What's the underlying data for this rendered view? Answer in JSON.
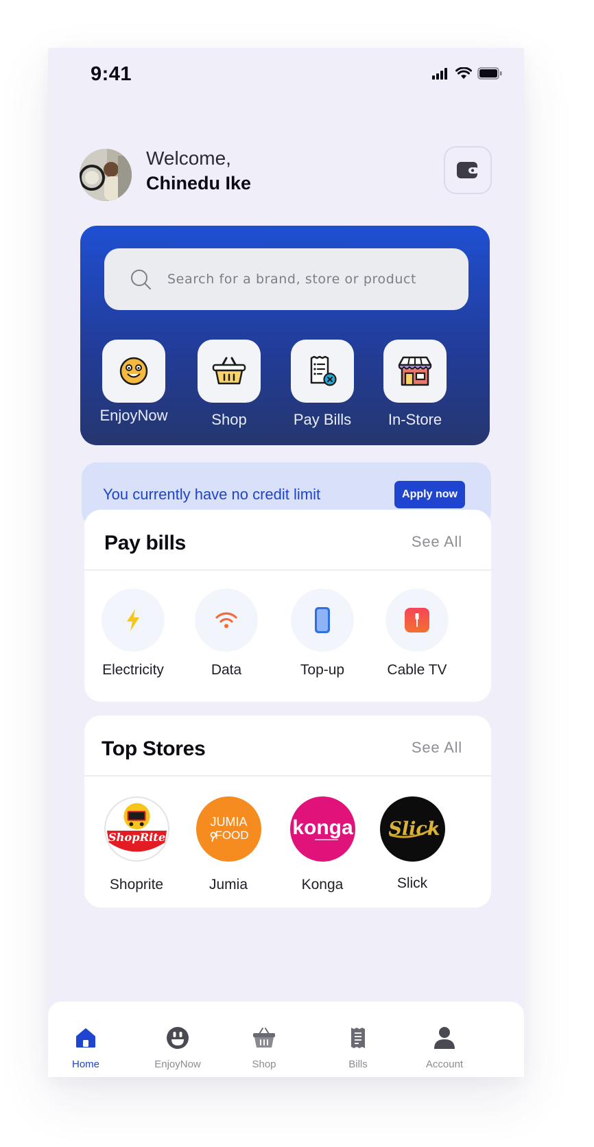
{
  "status_bar": {
    "time": "9:41"
  },
  "header": {
    "welcome": "Welcome,",
    "user_name": "Chinedu Ike"
  },
  "search": {
    "placeholder": "Search for a brand, store or product"
  },
  "quick_actions": [
    {
      "label": "EnjoyNow",
      "icon": "smiley-icon"
    },
    {
      "label": "Shop",
      "icon": "basket-icon"
    },
    {
      "label": "Pay Bills",
      "icon": "bill-icon"
    },
    {
      "label": "In-Store",
      "icon": "storefront-icon"
    }
  ],
  "credit_banner": {
    "message": "You currently have no credit limit",
    "button": "Apply now"
  },
  "pay_bills": {
    "title": "Pay bills",
    "see_all": "See All",
    "items": [
      {
        "label": "Electricity",
        "icon": "lightning-icon",
        "color": "#f5c518"
      },
      {
        "label": "Data",
        "icon": "wifi-icon",
        "color": "#f26b3a"
      },
      {
        "label": "Top-up",
        "icon": "phone-icon",
        "color": "#2f6fe0"
      },
      {
        "label": "Cable TV",
        "icon": "tv-icon",
        "color": "#f0433a"
      }
    ]
  },
  "top_stores": {
    "title": "Top Stores",
    "see_all": "See All",
    "stores": [
      {
        "label": "Shoprite",
        "logo_text": "ShopRite"
      },
      {
        "label": "Jumia",
        "logo_text_1": "JUMIA",
        "logo_text_2": "FOOD"
      },
      {
        "label": "Konga",
        "logo_text": "konga"
      },
      {
        "label": "Slick",
        "logo_text": "Slick"
      }
    ]
  },
  "bottom_nav": [
    {
      "label": "Home",
      "icon": "home-icon",
      "active": true
    },
    {
      "label": "EnjoyNow",
      "icon": "smiley-icon",
      "active": false
    },
    {
      "label": "Shop",
      "icon": "basket-icon",
      "active": false
    },
    {
      "label": "Bills",
      "icon": "receipt-icon",
      "active": false
    },
    {
      "label": "Account",
      "icon": "user-icon",
      "active": false
    }
  ],
  "colors": {
    "primary": "#1f44d0",
    "background": "#f0eef8",
    "credit_banner_bg": "#d8e0fa"
  }
}
